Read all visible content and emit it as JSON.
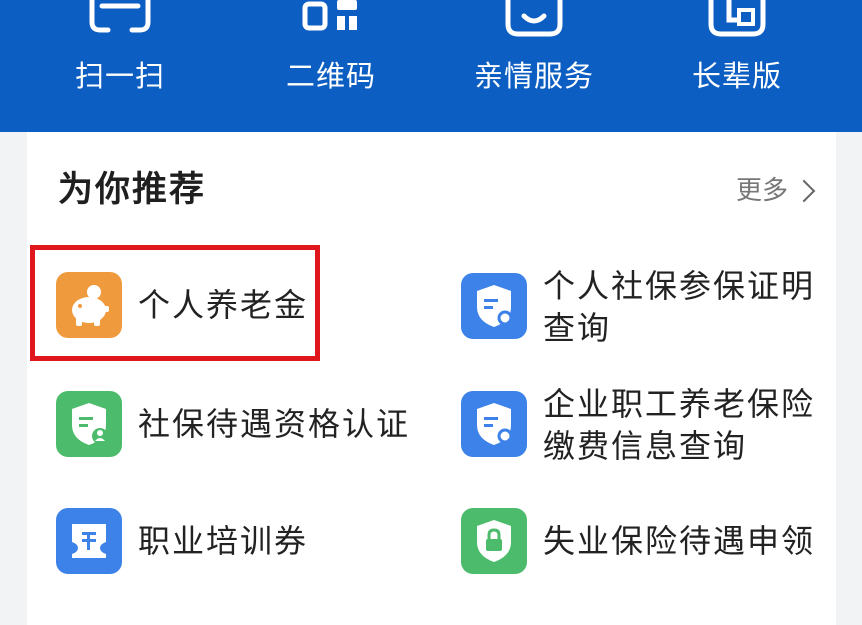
{
  "quick_actions": [
    {
      "label": "扫一扫",
      "icon": "scan-icon"
    },
    {
      "label": "二维码",
      "icon": "qr-code-icon"
    },
    {
      "label": "亲情服务",
      "icon": "family-service-icon"
    },
    {
      "label": "长辈版",
      "icon": "elder-mode-icon"
    }
  ],
  "recommend": {
    "title": "为你推荐",
    "more_label": "更多"
  },
  "services": [
    {
      "line1": "个人养老金",
      "line2": "",
      "icon": "piggy-bank-icon",
      "color": "#f09a3e"
    },
    {
      "line1": "个人社保参保证明",
      "line2": "查询",
      "icon": "shield-search-icon",
      "color": "#3d82e8"
    },
    {
      "line1": "社保待遇资格认证",
      "line2": "",
      "icon": "shield-user-icon",
      "color": "#4cbc6c"
    },
    {
      "line1": "企业职工养老保险",
      "line2": "缴费信息查询",
      "icon": "shield-search-icon",
      "color": "#3d82e8"
    },
    {
      "line1": "职业培训券",
      "line2": "",
      "icon": "voucher-icon",
      "color": "#3d82e8"
    },
    {
      "line1": "失业保险待遇申领",
      "line2": "",
      "icon": "shield-lock-icon",
      "color": "#4cbc6c"
    }
  ],
  "colors": {
    "banner": "#0d5ec2",
    "highlight": "#e0161d"
  }
}
